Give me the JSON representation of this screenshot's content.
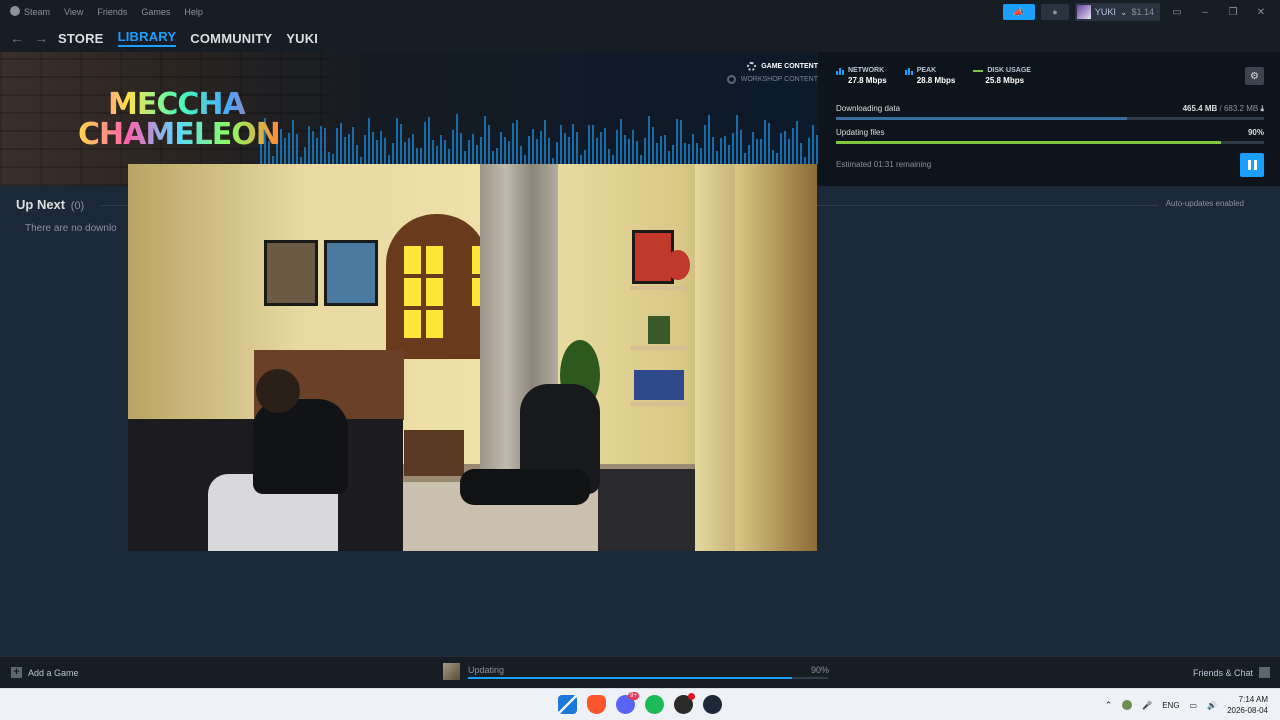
{
  "menubar": {
    "items": [
      "Steam",
      "View",
      "Friends",
      "Games",
      "Help"
    ],
    "user": {
      "name": "YUKI",
      "balance": "$1.14"
    }
  },
  "nav": {
    "links": [
      "STORE",
      "LIBRARY",
      "COMMUNITY",
      "YUKI"
    ],
    "active": "LIBRARY"
  },
  "download": {
    "game_logo": {
      "line1": "MECCHA",
      "line2": "CHAMELEON"
    },
    "content_types": {
      "game": "GAME CONTENT",
      "workshop": "WORKSHOP CONTENT"
    },
    "stats": {
      "network_label": "NETWORK",
      "network_value": "27.8 Mbps",
      "peak_label": "PEAK",
      "peak_value": "28.8 Mbps",
      "disk_label": "DISK USAGE",
      "disk_value": "25.8 Mbps"
    },
    "downloading": {
      "label": "Downloading data",
      "done": "465.4 MB",
      "total": "/ 683.2 MB",
      "fraction": 0.68
    },
    "updating": {
      "label": "Updating files",
      "percent_text": "90%",
      "fraction": 0.9
    },
    "estimate": "Estimated 01:31 remaining"
  },
  "upnext": {
    "title": "Up Next",
    "count": "(0)",
    "empty_text": "There are no downlo",
    "auto_updates": "Auto-updates enabled"
  },
  "bottombar": {
    "add_game": "Add a Game",
    "status": "Updating",
    "percent_text": "90%",
    "fraction": 0.9,
    "friends_chat": "Friends & Chat"
  },
  "taskbar": {
    "discord_badge": "9+",
    "lang": "ENG",
    "time": "7:14 AM",
    "date": "2026-08-04"
  },
  "colors": {
    "accent": "#1a9fff",
    "green": "#7ec83f",
    "background": "#1b2838"
  }
}
